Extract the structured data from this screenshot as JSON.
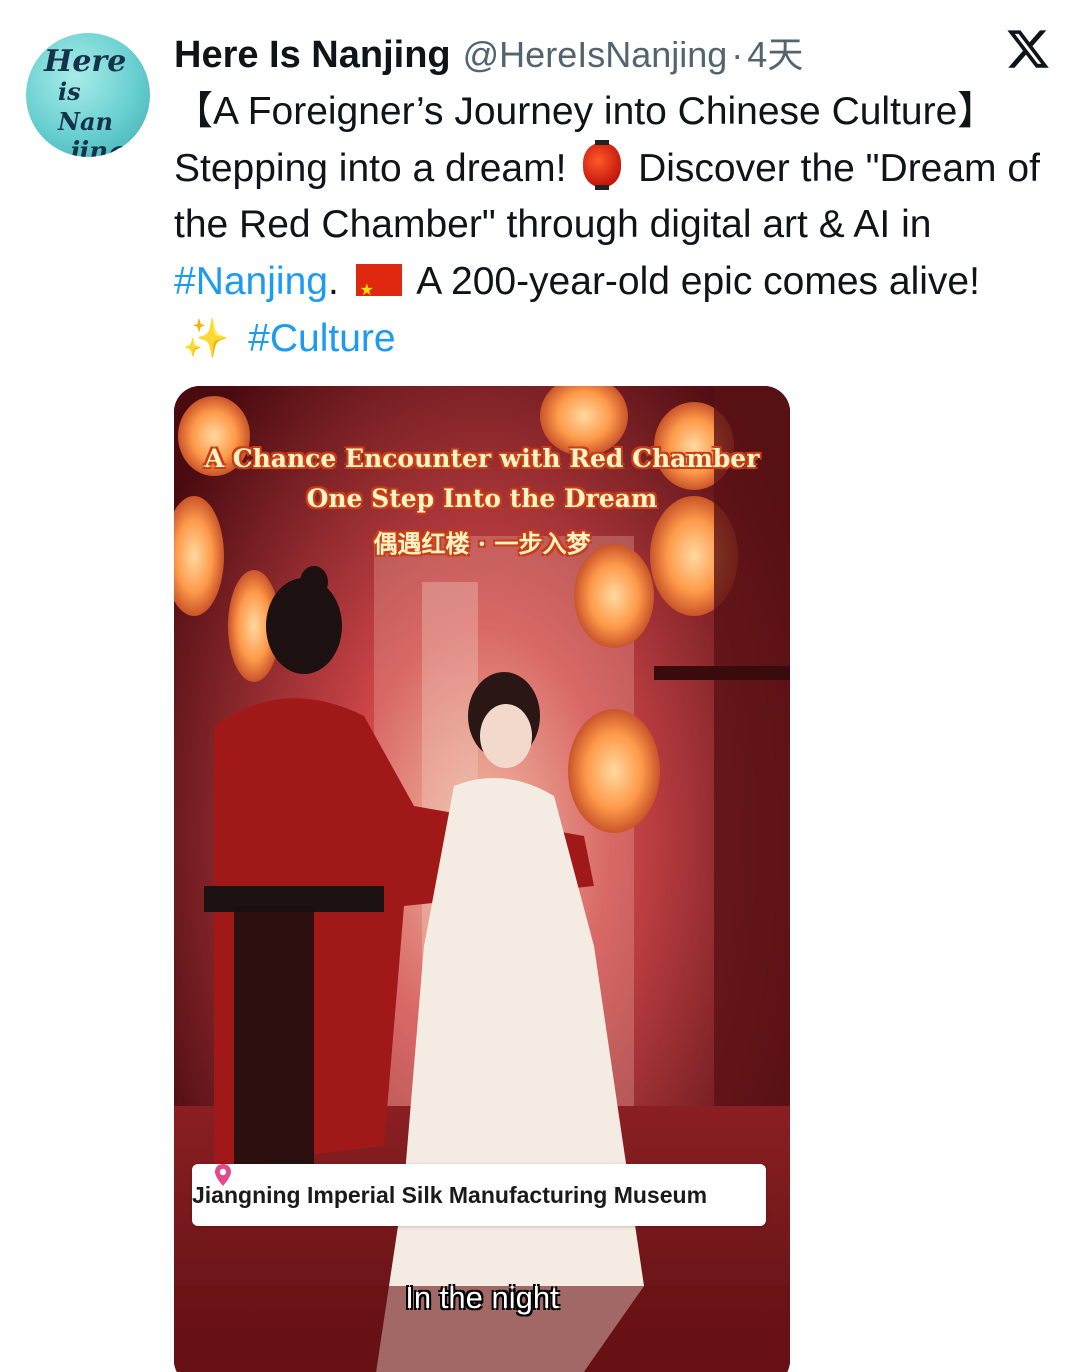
{
  "author": {
    "avatar_text": [
      "Here",
      "is Nan",
      "jing"
    ],
    "display_name": "Here Is Nanjing",
    "handle": "@HereIsNanjing",
    "separator": "·",
    "time": "4天"
  },
  "platform_icon": "x-logo-icon",
  "tweet": {
    "segments": [
      {
        "text": "【A Foreigner’s Journey into Chinese Culture】Stepping into a dream! ",
        "type": "text"
      },
      {
        "text": "",
        "type": "emoji",
        "icon": "red-lantern-icon"
      },
      {
        "text": " Discover the \"Dream of the Red Chamber\" through digital art & AI in ",
        "type": "text"
      },
      {
        "text": "#Nanjing",
        "type": "hashtag"
      },
      {
        "text": ". ",
        "type": "text"
      },
      {
        "text": "",
        "type": "emoji",
        "icon": "china-flag-icon"
      },
      {
        "text": " A 200-year-old epic comes alive! ",
        "type": "text"
      },
      {
        "text": "",
        "type": "emoji",
        "icon": "sparkles-icon"
      },
      {
        "text": " ",
        "type": "text"
      },
      {
        "text": "#Culture",
        "type": "hashtag"
      }
    ],
    "link_color": "#1d9bf0"
  },
  "media": {
    "title_line1": "A Chance Encounter with Red Chamber",
    "title_line2": "One Step Into the Dream",
    "title_line3": "偶遇红楼 · 一步入梦",
    "location_icon": "location-pin-icon",
    "location": "Jiangning Imperial Silk Manufacturing Museum",
    "subtitle": "In the night"
  }
}
